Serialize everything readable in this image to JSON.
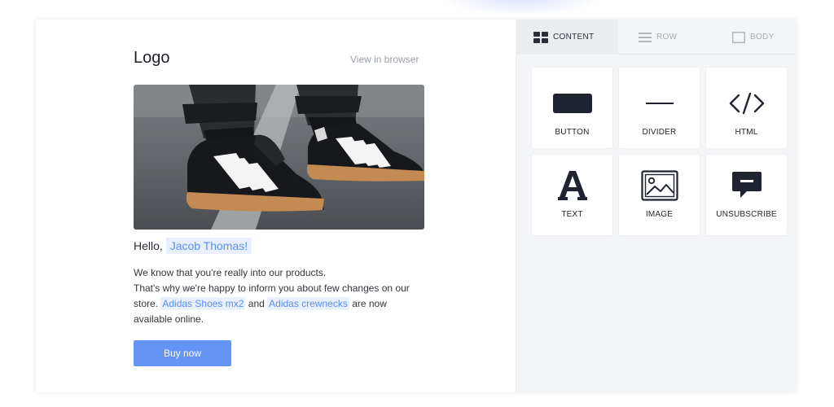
{
  "email": {
    "logo": "Logo",
    "view_in_browser": "View in browser",
    "greeting_prefix": "Hello,",
    "recipient_name": "Jacob Thomas!",
    "line1": "We know that you're really into our products.",
    "line2": "That's why we're happy to inform you about few changes on our",
    "line3_prefix": "store.",
    "product1": "Adidas Shoes mx2",
    "and_word": "and",
    "product2": "Adidas crewnecks",
    "line3_suffix": "are now",
    "line4": "available online.",
    "cta_label": "Buy now",
    "colors": {
      "accent": "#6495f6",
      "highlight_bg": "#e8f0fd",
      "link": "#5c8df0"
    }
  },
  "panel": {
    "tabs": [
      {
        "label": "CONTENT",
        "icon": "grid-icon",
        "active": true
      },
      {
        "label": "ROW",
        "icon": "rows-icon",
        "active": false
      },
      {
        "label": "BODY",
        "icon": "square-icon",
        "active": false
      }
    ],
    "blocks": [
      {
        "label": "BUTTON",
        "icon": "button-block-icon"
      },
      {
        "label": "DIVIDER",
        "icon": "divider-icon"
      },
      {
        "label": "HTML",
        "icon": "code-icon"
      },
      {
        "label": "TEXT",
        "icon": "text-a-icon"
      },
      {
        "label": "IMAGE",
        "icon": "image-icon"
      },
      {
        "label": "UNSUBSCRIBE",
        "icon": "chat-bubble-icon"
      }
    ]
  }
}
